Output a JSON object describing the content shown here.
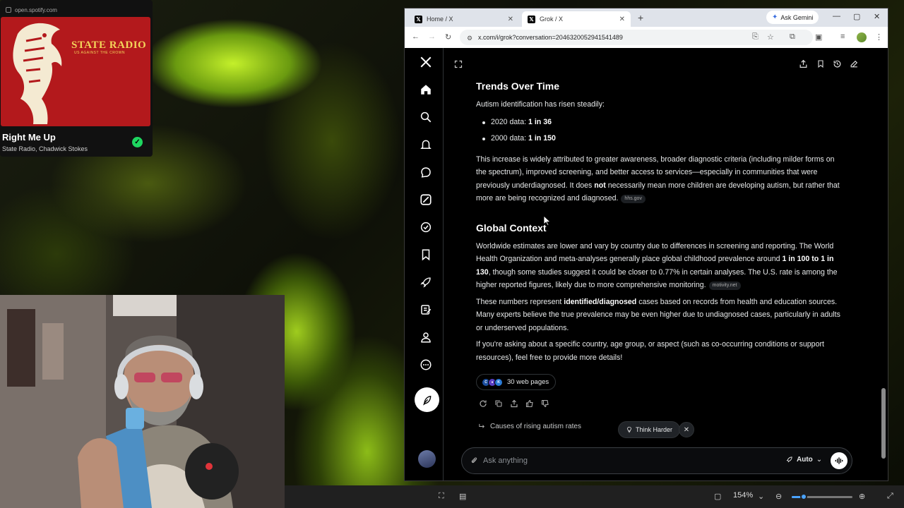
{
  "spotify": {
    "url": "open.spotify.com",
    "album_band": "STATE RADIO",
    "album_subtitle": "US AGAINST THE CROWN",
    "track": "Right Me Up",
    "artists": "State Radio, Chadwick Stokes",
    "liked_icon": "checkmark-icon",
    "accent": "#1ed760"
  },
  "browser": {
    "tabs": [
      {
        "label": "Home / X",
        "active": false
      },
      {
        "label": "Grok / X",
        "active": true
      }
    ],
    "ask_gemini": "Ask Gemini",
    "url": "x.com/i/grok?conversation=2046320052941541489"
  },
  "grok": {
    "section1": {
      "heading": "Trends Over Time",
      "intro": "Autism identification has risen steadily:",
      "bullets": [
        {
          "label": "2020 data: ",
          "value": "1 in 36"
        },
        {
          "label": "2000 data: ",
          "value": "1 in 150"
        }
      ],
      "para_a": "This increase is widely attributed to greater awareness, broader diagnostic criteria (including milder forms on the spectrum), improved screening, and better access to services—especially in communities that were previously underdiagnosed. It does ",
      "para_bold": "not",
      "para_b": " necessarily mean more children are developing autism, but rather that more are being recognized and diagnosed.",
      "cite": "hhs.gov"
    },
    "section2": {
      "heading": "Global Context",
      "para1_a": "Worldwide estimates are lower and vary by country due to differences in screening and reporting. The World Health Organization and meta-analyses generally place global childhood prevalence around ",
      "para1_bold": "1 in 100 to 1 in 130",
      "para1_b": ", though some studies suggest it could be closer to 0.77% in certain analyses. The U.S. rate is among the higher reported figures, likely due to more comprehensive monitoring.",
      "cite": "motivity.net",
      "para2_a": "These numbers represent ",
      "para2_bold": "identified/diagnosed",
      "para2_b": " cases based on records from health and education sources. Many experts believe the true prevalence may be even higher due to undiagnosed cases, particularly in adults or underserved populations.",
      "para3": "If you're asking about a specific country, age group, or aspect (such as co-occurring conditions or support resources), feel free to provide more details!"
    },
    "sources_label": "30 web pages",
    "suggestion": "Causes of rising autism rates",
    "think_harder": "Think Harder",
    "ask_placeholder": "Ask anything",
    "mode": "Auto"
  },
  "bottombar": {
    "zoom": "154%",
    "zoom_level": 0.2
  }
}
